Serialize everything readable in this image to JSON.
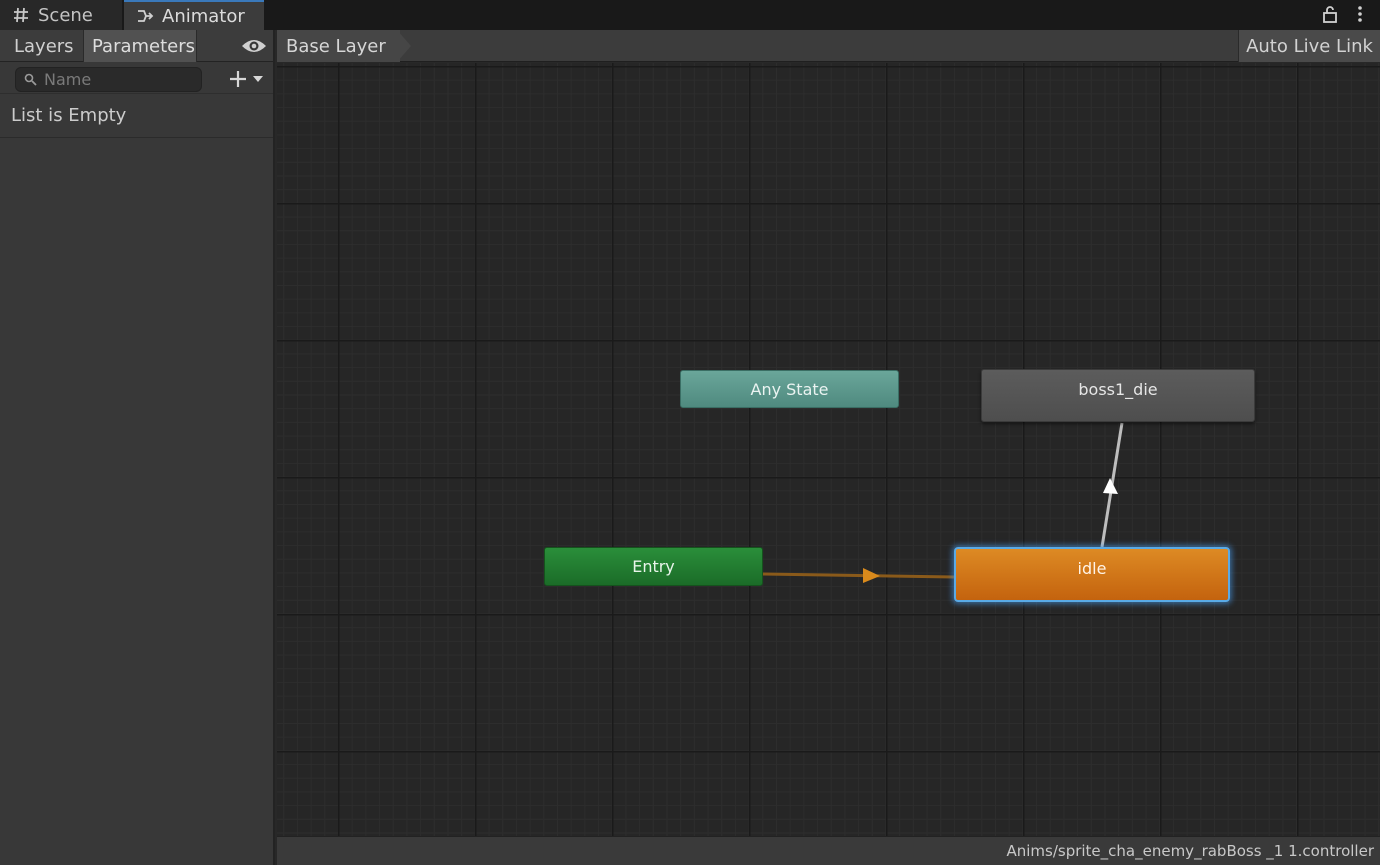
{
  "tabs": [
    {
      "label": "Scene",
      "icon": "hash-icon"
    },
    {
      "label": "Animator",
      "icon": "animator-icon"
    }
  ],
  "left_panel": {
    "layers_label": "Layers",
    "parameters_label": "Parameters",
    "search_placeholder": "Name",
    "empty_text": "List is Empty"
  },
  "graph_header": {
    "breadcrumb": "Base Layer",
    "auto_live_link": "Auto Live Link"
  },
  "states": {
    "any": {
      "label": "Any State",
      "color": "#5e9c90"
    },
    "die": {
      "label": "boss1_die",
      "color": "#555555"
    },
    "entry": {
      "label": "Entry",
      "color": "#23823a"
    },
    "idle": {
      "label": "idle",
      "color": "#d77c1c",
      "selected": true
    }
  },
  "transitions": [
    {
      "from": "Entry",
      "to": "idle",
      "color": "#a0681c"
    },
    {
      "from": "idle",
      "to": "boss1_die",
      "color": "#bcbcbc"
    }
  ],
  "status": {
    "path": "Anims/sprite_cha_enemy_rabBoss _1 1.controller"
  }
}
